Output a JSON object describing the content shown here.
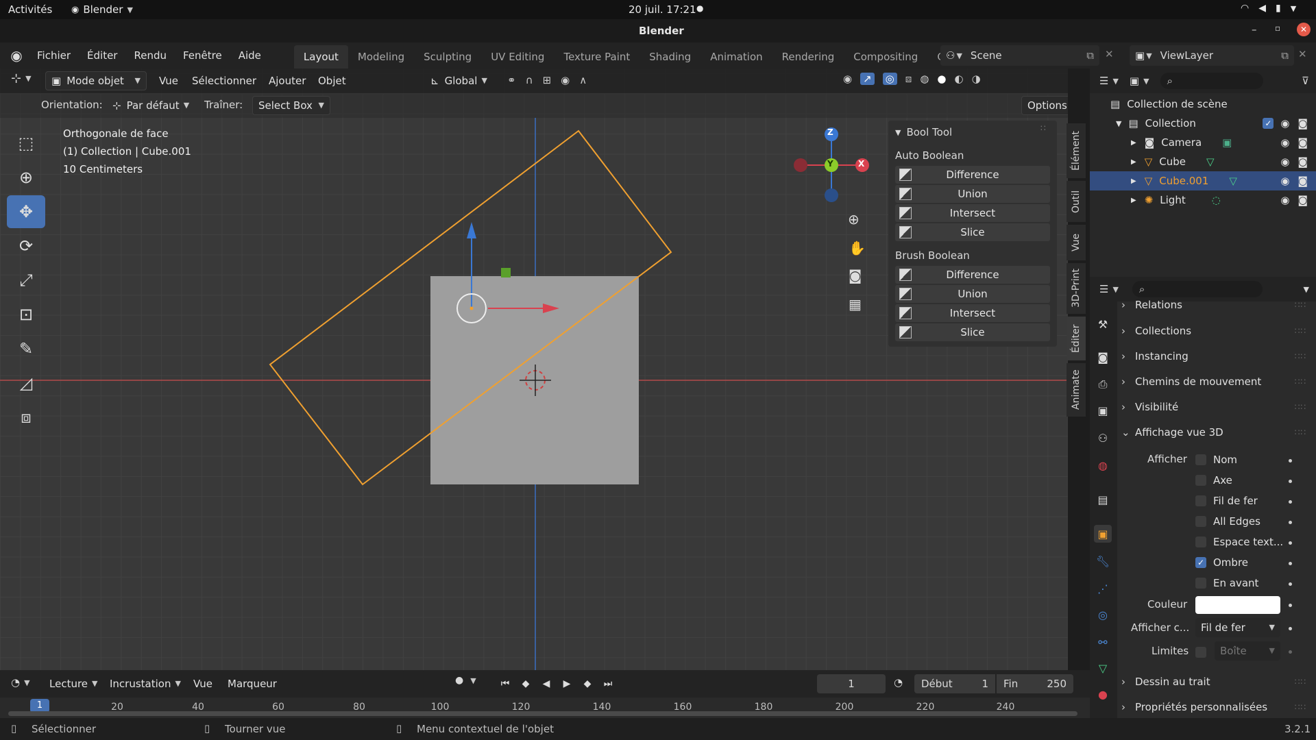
{
  "system_bar": {
    "activities": "Activités",
    "app_menu": "Blender",
    "datetime": "20 juil.  17:21"
  },
  "window": {
    "title": "Blender"
  },
  "menus": [
    "Fichier",
    "Éditer",
    "Rendu",
    "Fenêtre",
    "Aide"
  ],
  "workspaces": [
    "Layout",
    "Modeling",
    "Sculpting",
    "UV Editing",
    "Texture Paint",
    "Shading",
    "Animation",
    "Rendering",
    "Compositing",
    "Geomet"
  ],
  "active_workspace": "Layout",
  "scene": {
    "name": "Scene"
  },
  "view_layer": {
    "name": "ViewLayer"
  },
  "viewport_header": {
    "mode": "Mode objet",
    "menus": [
      "Vue",
      "Sélectionner",
      "Ajouter",
      "Objet"
    ],
    "transform_orientation": "Global"
  },
  "tool_settings": {
    "orientation_label": "Orientation:",
    "orientation_value": "Par défaut",
    "drag_label": "Traîner:",
    "drag_value": "Select Box",
    "options": "Options"
  },
  "viewport_info": {
    "line1": "Orthogonale de face",
    "line2": "(1) Collection | Cube.001",
    "line3": "10 Centimeters"
  },
  "gizmo": {
    "z": "Z",
    "y": "Y",
    "x": "X"
  },
  "bool_tool": {
    "title": "Bool Tool",
    "auto_label": "Auto Boolean",
    "auto_ops": [
      "Difference",
      "Union",
      "Intersect",
      "Slice"
    ],
    "brush_label": "Brush Boolean",
    "brush_ops": [
      "Difference",
      "Union",
      "Intersect",
      "Slice"
    ]
  },
  "sidebar_tabs": [
    "Élément",
    "Outil",
    "Vue",
    "3D-Print",
    "Éditer",
    "Animate"
  ],
  "outliner": {
    "scene_collection": "Collection de scène",
    "collection": "Collection",
    "items": [
      "Camera",
      "Cube",
      "Cube.001",
      "Light"
    ],
    "selected": "Cube.001"
  },
  "properties": {
    "sections_top": [
      "Relations",
      "Collections",
      "Instancing",
      "Chemins de mouvement",
      "Visibilité"
    ],
    "viewport_display": "Affichage vue 3D",
    "show_label": "Afficher",
    "checkboxes": [
      {
        "label": "Nom",
        "checked": false
      },
      {
        "label": "Axe",
        "checked": false
      },
      {
        "label": "Fil de fer",
        "checked": false
      },
      {
        "label": "All Edges",
        "checked": false
      },
      {
        "label": "Espace text...",
        "checked": false
      },
      {
        "label": "Ombre",
        "checked": true
      },
      {
        "label": "En avant",
        "checked": false
      }
    ],
    "color_label": "Couleur",
    "color_value": "#ffffff",
    "display_as_label": "Afficher c...",
    "display_as_value": "Fil de fer",
    "bounds_label": "Limites",
    "bounds_value": "Boîte",
    "sections_bottom": [
      "Dessin au trait",
      "Propriétés personnalisées"
    ]
  },
  "timeline": {
    "menus": [
      "Lecture",
      "Incrustation",
      "Vue",
      "Marqueur"
    ],
    "current_frame": "1",
    "start_label": "Début",
    "start_value": "1",
    "end_label": "Fin",
    "end_value": "250",
    "ticks": [
      "20",
      "40",
      "60",
      "80",
      "100",
      "120",
      "140",
      "160",
      "180",
      "200",
      "220",
      "240"
    ],
    "playhead": "1"
  },
  "status_bar": {
    "select": "Sélectionner",
    "rotate": "Tourner vue",
    "context": "Menu contextuel de l'objet",
    "version": "3.2.1"
  },
  "colors": {
    "accent": "#4772b3",
    "selection_orange": "#f0a030",
    "x_axis": "#d9424f",
    "y_axis": "#8ccc2a",
    "z_axis": "#3a78d4"
  },
  "icons": [
    "blender-logo-icon",
    "search-icon",
    "filter-icon",
    "eye-icon",
    "camera-render-icon",
    "checkbox-icon"
  ]
}
